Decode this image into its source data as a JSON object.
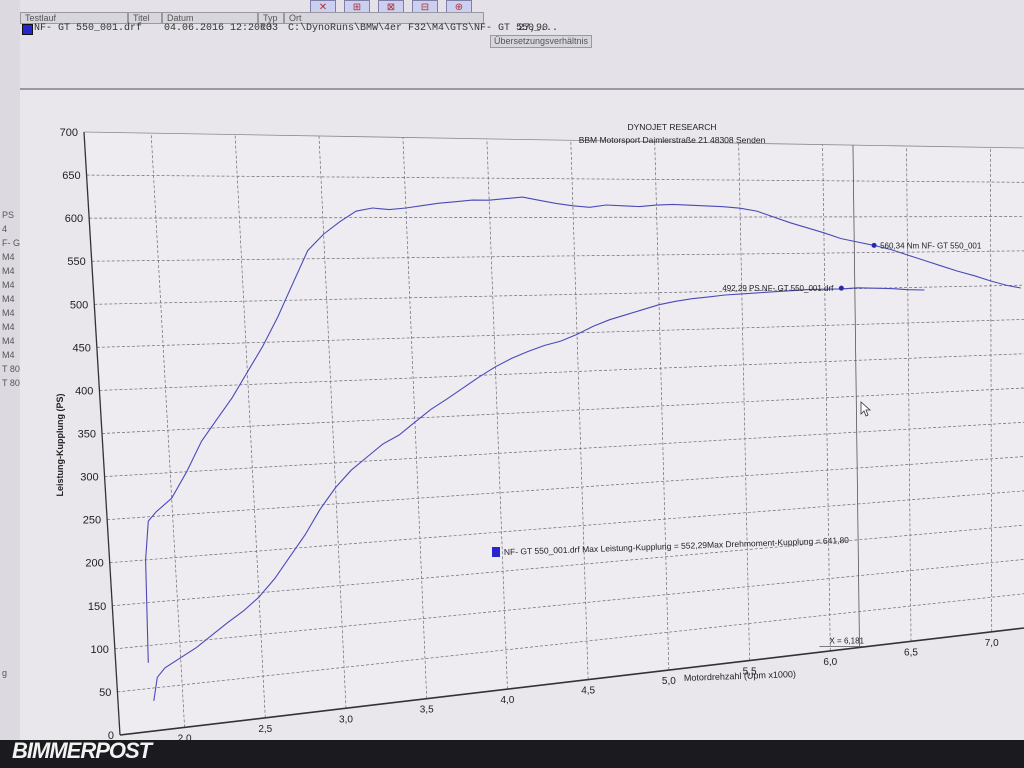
{
  "window": {
    "columns": [
      {
        "label": "Testlauf",
        "width": 108
      },
      {
        "label": "Titel",
        "width": 34
      },
      {
        "label": "Datum",
        "width": 96
      },
      {
        "label": "Typ",
        "width": 26
      },
      {
        "label": "Ort",
        "width": 200
      }
    ],
    "extra_column": "Übersetzungsverhältnis",
    "file": {
      "name": "NF- GT 550_001.drf",
      "date": "04.06.2016 12:20:33",
      "type": "RO",
      "path": "C:\\DynoRuns\\BMW\\4er F32\\M4\\GTS\\NF- GT 550_...",
      "ratio": "27,90"
    },
    "toolbar": [
      "✕",
      "⊞",
      "⊠",
      "⊟",
      "⊕"
    ],
    "left_ticks": [
      "PS",
      "4",
      "F- G",
      "M4",
      "M4",
      "M4",
      "M4",
      "M4",
      "M4",
      "M4",
      "M4",
      "T 80",
      "T 80",
      "g"
    ],
    "watermark": "BIMMERPOST"
  },
  "chart_data": {
    "type": "line",
    "title": "DYNOJET RESEARCH",
    "subtitle": "BBM Motorsport Daimlerstraße 21 48308 Senden",
    "xlabel": "Motordrehzahl (Upm x1000)",
    "ylabel": "Leistung-Kupplung (PS)",
    "xlim": [
      1.6,
      7.2
    ],
    "ylim": [
      0,
      700
    ],
    "x_ticks": [
      "2,0",
      "2,5",
      "3,0",
      "3,5",
      "4,0",
      "4,5",
      "5,0",
      "5,5",
      "6,0",
      "6,5",
      "7,0"
    ],
    "x_tick_values": [
      2.0,
      2.5,
      3.0,
      3.5,
      4.0,
      4.5,
      5.0,
      5.5,
      6.0,
      6.5,
      7.0
    ],
    "y_ticks": [
      0,
      50,
      100,
      150,
      200,
      250,
      300,
      350,
      400,
      450,
      500,
      550,
      600,
      650,
      700
    ],
    "grid": true,
    "series": [
      {
        "key": "torque",
        "color": "#4a4ab8",
        "x": [
          1.8,
          1.82,
          1.85,
          1.9,
          2.0,
          2.1,
          2.2,
          2.3,
          2.4,
          2.5,
          2.6,
          2.7,
          2.8,
          2.9,
          3.0,
          3.1,
          3.2,
          3.3,
          3.4,
          3.5,
          3.6,
          3.7,
          3.8,
          3.9,
          4.0,
          4.1,
          4.2,
          4.3,
          4.4,
          4.5,
          4.6,
          4.7,
          4.8,
          4.9,
          5.0,
          5.1,
          5.2,
          5.3,
          5.4,
          5.5,
          5.6,
          5.7,
          5.8,
          5.9,
          6.0,
          6.1,
          6.2,
          6.3,
          6.4,
          6.5,
          6.6,
          6.7,
          6.8,
          6.9,
          7.0,
          7.1,
          7.18
        ],
        "y": [
          80,
          200,
          245,
          255,
          270,
          300,
          335,
          360,
          385,
          415,
          445,
          480,
          520,
          560,
          580,
          595,
          608,
          612,
          610,
          612,
          615,
          618,
          620,
          622,
          622,
          624,
          626,
          622,
          618,
          615,
          613,
          616,
          615,
          614,
          616,
          617,
          616,
          615,
          614,
          612,
          608,
          600,
          592,
          585,
          578,
          570,
          565,
          560,
          554,
          546,
          538,
          530,
          522,
          515,
          507,
          500,
          496
        ]
      },
      {
        "key": "power",
        "color": "#4a4ab8",
        "x": [
          1.82,
          1.85,
          1.9,
          2.0,
          2.1,
          2.2,
          2.3,
          2.4,
          2.5,
          2.6,
          2.7,
          2.8,
          2.9,
          3.0,
          3.1,
          3.2,
          3.3,
          3.4,
          3.5,
          3.6,
          3.7,
          3.8,
          3.9,
          4.0,
          4.1,
          4.2,
          4.3,
          4.4,
          4.5,
          4.6,
          4.7,
          4.8,
          4.9,
          5.0,
          5.1,
          5.2,
          5.3,
          5.4,
          5.5,
          5.6,
          5.7,
          5.8,
          5.9,
          6.0,
          6.1,
          6.2,
          6.3,
          6.4,
          6.5,
          6.6
        ],
        "y": [
          35,
          62,
          72,
          82,
          92,
          105,
          118,
          130,
          145,
          165,
          190,
          215,
          245,
          270,
          290,
          305,
          320,
          330,
          345,
          360,
          372,
          385,
          398,
          410,
          420,
          428,
          435,
          440,
          448,
          458,
          466,
          472,
          478,
          484,
          488,
          491,
          493,
          495,
          496,
          497,
          498,
          499,
          500,
          500,
          500,
          501,
          500,
          499,
          497,
          496
        ]
      }
    ],
    "annotations": [
      {
        "text": "560,34 Nm NF- GT 550_001",
        "x": 6.3,
        "y": 560
      },
      {
        "text": "492,29 PS NF- GT 550_001.drf",
        "x": 6.1,
        "y": 501
      },
      {
        "text": "X = 6,181",
        "x": 6.181
      }
    ],
    "legend": {
      "position": "center",
      "text": "NF- GT 550_001.drf Max Leistung-Kupplung = 552,29Max Drehmoment-Kupplung = 641,80",
      "color": "#2626cc"
    }
  }
}
